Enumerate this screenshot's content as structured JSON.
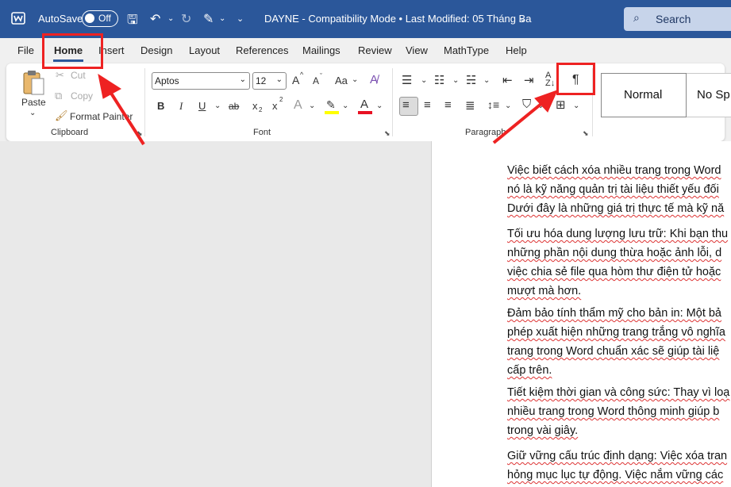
{
  "titlebar": {
    "autosave_label": "AutoSave",
    "toggle_label": "Off",
    "title": "DAYNE  -  Compatibility Mode  •  Last Modified: 05 Tháng Ba",
    "search_label": "Search"
  },
  "menu": {
    "tabs": [
      "File",
      "Home",
      "Insert",
      "Design",
      "Layout",
      "References",
      "Mailings",
      "Review",
      "View",
      "MathType",
      "Help"
    ]
  },
  "clipboard": {
    "paste": "Paste",
    "cut": "Cut",
    "copy": "Copy",
    "format_painter": "Format Painter",
    "label": "Clipboard"
  },
  "font": {
    "name": "Aptos",
    "size": "12",
    "label": "Font",
    "grow": "A",
    "shrink": "A",
    "case": "Aa",
    "bold": "B",
    "italic": "I",
    "underline": "U",
    "strike": "ab",
    "subscript": "x",
    "superscript": "x"
  },
  "paragraph": {
    "label": "Paragraph",
    "pilcrow": "¶"
  },
  "styles": {
    "normal": "Normal",
    "no_spacing": "No Sp"
  },
  "document": {
    "paragraphs": [
      [
        "Việc biết cách xóa nhiều trang trong Word",
        "nó là kỹ năng quản trị tài liệu thiết yếu đối",
        "Dưới đây là những giá trị thực tế mà kỹ nă"
      ],
      [
        "Tối ưu hóa dung lượng lưu trữ: Khi bạn thu",
        "những phần nội dung thừa hoặc ảnh lỗi, d",
        "việc chia sẻ file qua hòm thư điện tử hoặc",
        "mượt mà hơn."
      ],
      [
        "Đảm bảo tính thẩm mỹ cho bản in: Một bả",
        "phép xuất hiện những trang trắng vô nghĩa",
        "trang trong Word chuẩn xác sẽ giúp tài liệ",
        "cấp trên."
      ],
      [
        "Tiết kiệm thời gian và công sức: Thay vì loạ",
        "nhiều trang trong Word thông minh giúp b",
        "trong vài giây."
      ],
      [
        "Giữ vững cấu trúc định dạng: Việc xóa tran",
        "hỏng mục lục tự động. Việc nắm vững các"
      ]
    ]
  },
  "colors": {
    "title_bar": "#2b579a",
    "highlight": "#ffff00",
    "font_color": "#e81123",
    "annotation": "#ee2222"
  }
}
